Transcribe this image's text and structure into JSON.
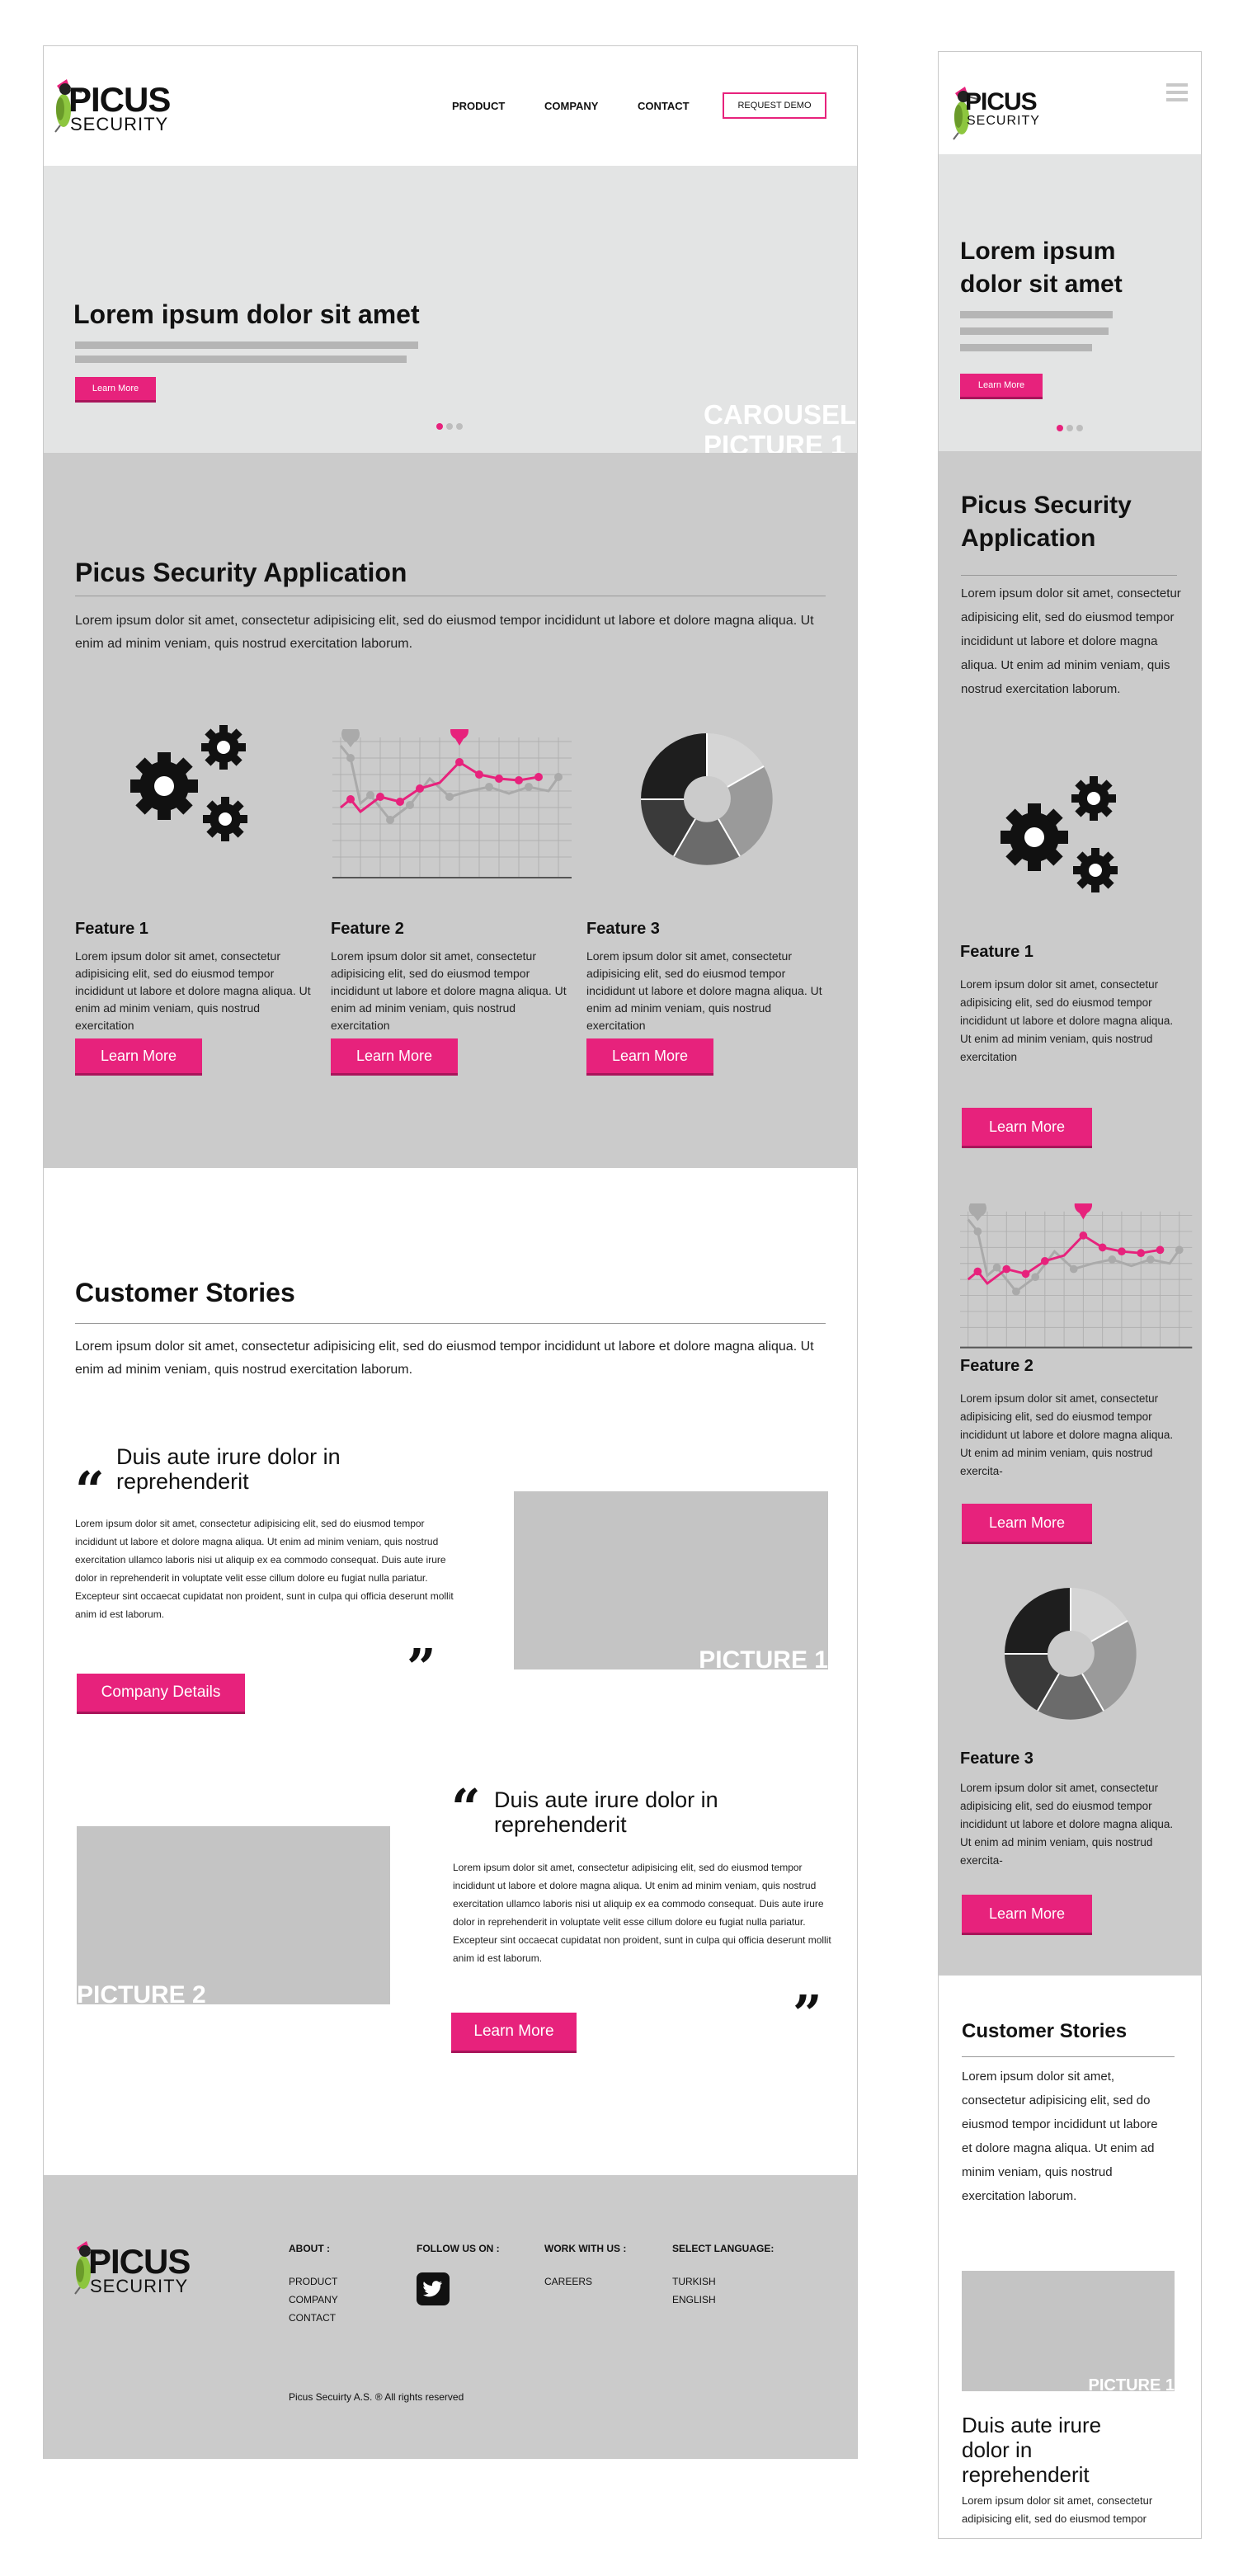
{
  "brand": {
    "name": "PICUS",
    "sub": "SECURITY"
  },
  "nav": {
    "product": "PRODUCT",
    "company": "COMPANY",
    "contact": "CONTACT",
    "demo": "REQUEST DEMO"
  },
  "hero": {
    "title": "Lorem ipsum dolor sit amet",
    "mobile_title": "Lorem ipsum dolor sit amet",
    "button": "Learn More",
    "watermark": "CAROUSEL PICTURE 1"
  },
  "app": {
    "title": "Picus Security Application",
    "text": "Lorem ipsum dolor sit amet, consectetur adipisicing elit, sed do eiusmod tempor incididunt ut labore et dolore magna aliqua. Ut enim ad minim veniam, quis nostrud exercitation laborum.",
    "features": [
      {
        "title": "Feature 1",
        "text": "Lorem ipsum dolor sit amet, consectetur adipisicing elit, sed do eiusmod tempor incididunt ut labore et dolore magna aliqua. Ut enim ad minim veniam, quis nostrud exercitation",
        "button": "Learn More"
      },
      {
        "title": "Feature 2",
        "text": "Lorem ipsum dolor sit amet, consectetur adipisicing elit, sed do eiusmod tempor incididunt ut labore et dolore magna aliqua. Ut enim ad minim veniam, quis nostrud exercitation",
        "button": "Learn More"
      },
      {
        "title": "Feature 3",
        "text": "Lorem ipsum dolor sit amet, consectetur adipisicing elit, sed do eiusmod tempor incididunt ut labore et dolore magna aliqua. Ut enim ad minim veniam, quis nostrud exercitation",
        "button": "Learn More"
      }
    ]
  },
  "stories": {
    "title": "Customer Stories",
    "text": "Lorem ipsum dolor sit amet, consectetur adipisicing elit, sed do eiusmod tempor incididunt ut labore et dolore magna aliqua. Ut enim ad minim veniam, quis nostrud exercitation laborum.",
    "quote_title": "Duis aute irure dolor in reprehenderit",
    "quote_text": "Lorem ipsum dolor sit amet, consectetur adipisicing elit, sed do eiusmod tempor incididunt ut labore et dolore magna aliqua. Ut enim ad minim veniam, quis nostrud exercitation ullamco laboris nisi ut aliquip ex ea commodo consequat. Duis aute irure dolor in reprehenderit in voluptate velit esse cillum dolore eu fugiat nulla pariatur. Excepteur sint occaecat cupidatat non proident, sunt in culpa qui officia deserunt mollit anim id est laborum.",
    "company_button": "Company Details",
    "learn_button": "Learn More",
    "picture1": "PICTURE 1",
    "picture2": "PICTURE 2"
  },
  "footer": {
    "about": "ABOUT :",
    "about_links": [
      "PRODUCT",
      "COMPANY",
      "CONTACT"
    ],
    "follow": "FOLLOW US ON :",
    "work": "WORK WITH US :",
    "work_links": [
      "CAREERS"
    ],
    "lang": "SELECT LANGUAGE:",
    "lang_links": [
      "TURKISH",
      "ENGLISH"
    ],
    "copyright": "Picus Secuirty A.S. ® All rights reserved"
  },
  "mobile": {
    "app_text": "Lorem ipsum dolor sit amet, consectetur adipisicing elit, sed do eiusmod tempor incididunt ut labore et dolore magna aliqua. Ut enim ad minim veniam, quis nostrud exercitation laborum.",
    "feature_text1": "Lorem ipsum dolor sit amet, consectetur adipisicing elit, sed do eiusmod tempor incididunt ut labore et dolore magna aliqua. Ut enim ad minim veniam, quis nostrud exercitation",
    "feature_text2": "Lorem ipsum dolor sit amet, consectetur adipisicing elit, sed do eiusmod tempor incididunt ut labore et dolore magna aliqua. Ut enim ad minim veniam, quis nostrud exercita-",
    "feature_text3": "Lorem ipsum dolor sit amet, consectetur adipisicing elit, sed do eiusmod tempor incididunt ut labore et dolore magna aliqua. Ut enim ad minim veniam, quis nostrud exercita-",
    "stories_text": "Lorem ipsum dolor sit amet, consectetur adipisicing elit, sed do eiusmod tempor incididunt ut labore et dolore magna aliqua. Ut enim ad minim veniam, quis nostrud exercitation laborum.",
    "quote_title": "Duis aute irure dolor in reprehenderit",
    "quote_text": "Lorem ipsum dolor sit amet, consectetur adipisicing elit, sed do eiusmod tempor"
  },
  "colors": {
    "accent": "#e7227c",
    "panel": "#cbcbcb",
    "hero": "#e3e4e4"
  },
  "icons": [
    "gears-icon",
    "line-chart-icon",
    "donut-chart-icon",
    "twitter-icon",
    "woodpecker-logo",
    "hamburger-menu-icon"
  ]
}
